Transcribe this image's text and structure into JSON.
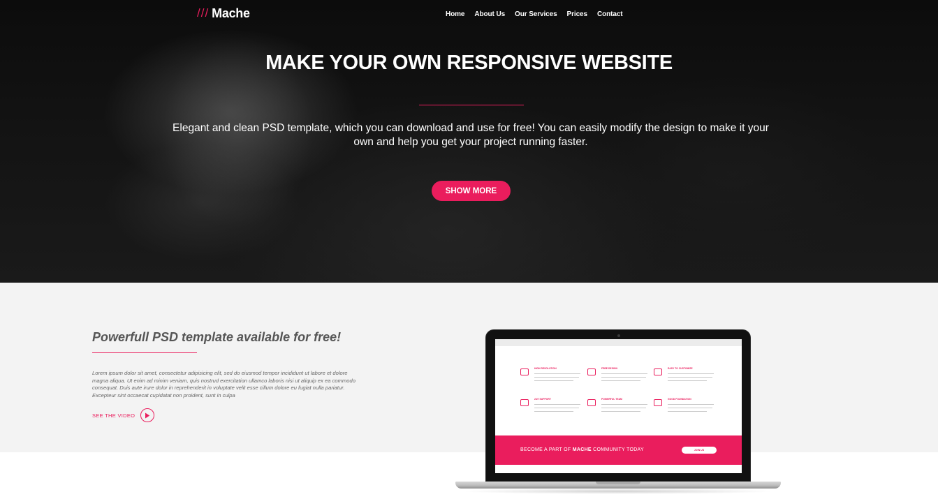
{
  "brand": {
    "slashes": "///",
    "name": "Mache"
  },
  "nav": {
    "items": [
      "Home",
      "About Us",
      "Our Services",
      "Prices",
      "Contact"
    ]
  },
  "hero": {
    "title": "MAKE YOUR OWN RESPONSIVE WEBSITE",
    "subtitle": "Elegant and clean PSD template, which you can download and use for free! You can easily modify the design to make it your own and help you get your project running faster.",
    "button_label": "SHOW MORE"
  },
  "feature": {
    "title": "Powerfull PSD template available for free!",
    "body": "Lorem ipsum dolor sit amet, consectetur adipisicing elit, sed do eiusmod tempor incididunt ut labore et dolore magna aliqua. Ut enim ad minim veniam, quis nostrud exercitation ullamco laboris nisi ut aliquip ex ea commodo consequat. Duis aute irure dolor in reprehenderit in voluptate velit esse cillum dolore eu fugiat nulla pariatur. Excepteur sint occaecat cupidatat non proident, sunt in culpa",
    "video_label": "SEE THE VIDEO"
  },
  "laptop_screen": {
    "services": [
      "HIGH RESOLUTION",
      "FREE DESIGN",
      "EASY TO CUSTOMIZE",
      "24/7 SUPPORT",
      "POWERFUL TEAM",
      "GOOD FOUNDATION"
    ],
    "banner_prefix": "BECOME A PART OF ",
    "banner_brand": "MACHE",
    "banner_suffix": " COMMUNITY TODAY",
    "banner_button": "JOIN US"
  },
  "colors": {
    "accent": "#ea1d5d",
    "hero_bg": "#111111",
    "feature_bg": "#f3f3f3"
  }
}
